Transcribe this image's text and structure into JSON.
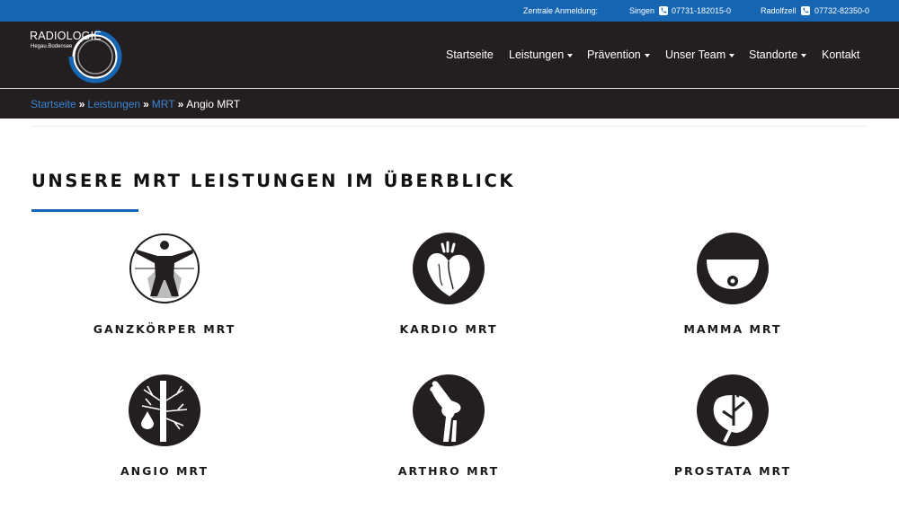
{
  "topbar": {
    "label": "Zentrale Anmeldung:",
    "locations": [
      {
        "city": "Singen",
        "phone": "07731-182015-0"
      },
      {
        "city": "Radolfzell",
        "phone": "07732-82350-0"
      }
    ]
  },
  "logo": {
    "name": "RADIOLOGIE",
    "sub": "Hegau.Bodensee"
  },
  "nav": [
    {
      "label": "Startseite"
    },
    {
      "label": "Leistungen"
    },
    {
      "label": "Prävention"
    },
    {
      "label": "Unser Team"
    },
    {
      "label": "Standorte"
    },
    {
      "label": "Kontakt"
    }
  ],
  "breadcrumb": {
    "items": [
      "Startseite",
      "Leistungen",
      "MRT",
      "Angio MRT"
    ],
    "separator": "»"
  },
  "section": {
    "title": "UNSERE MRT LEISTUNGEN IM ÜBERBLICK"
  },
  "services": [
    {
      "label": "GANZKÖRPER MRT",
      "icon": "full-body-icon"
    },
    {
      "label": "KARDIO MRT",
      "icon": "heart-icon"
    },
    {
      "label": "MAMMA MRT",
      "icon": "breast-icon"
    },
    {
      "label": "ANGIO MRT",
      "icon": "vessel-icon"
    },
    {
      "label": "ARTHRO MRT",
      "icon": "joint-icon"
    },
    {
      "label": "PROSTATA MRT",
      "icon": "prostate-icon"
    }
  ],
  "colors": {
    "brand_blue": "#1565b3",
    "dark": "#231f20",
    "link": "#3b86d6"
  }
}
